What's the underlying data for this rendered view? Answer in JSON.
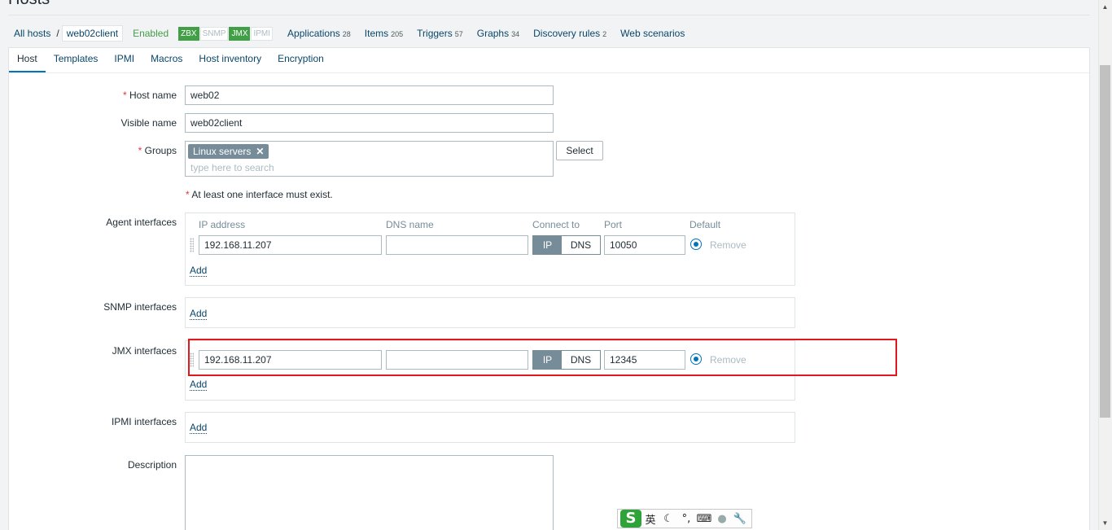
{
  "page": {
    "title": "Hosts"
  },
  "nav": {
    "all_hosts": "All hosts",
    "separator": "/",
    "current_host": "web02client",
    "status": "Enabled",
    "availability": [
      {
        "label": "ZBX",
        "active": true
      },
      {
        "label": "SNMP",
        "active": false
      },
      {
        "label": "JMX",
        "active": true
      },
      {
        "label": "IPMI",
        "active": false
      }
    ],
    "links": [
      {
        "label": "Applications",
        "count": "28"
      },
      {
        "label": "Items",
        "count": "205"
      },
      {
        "label": "Triggers",
        "count": "57"
      },
      {
        "label": "Graphs",
        "count": "34"
      },
      {
        "label": "Discovery rules",
        "count": "2"
      },
      {
        "label": "Web scenarios",
        "count": ""
      }
    ]
  },
  "tabs": [
    "Host",
    "Templates",
    "IPMI",
    "Macros",
    "Host inventory",
    "Encryption"
  ],
  "active_tab": "Host",
  "form": {
    "host_name_label": "Host name",
    "host_name_value": "web02",
    "visible_name_label": "Visible name",
    "visible_name_value": "web02client",
    "groups_label": "Groups",
    "group_chip": "Linux servers",
    "groups_placeholder": "type here to search",
    "select_button": "Select",
    "interface_note": "At least one interface must exist.",
    "agent_label": "Agent interfaces",
    "snmp_label": "SNMP interfaces",
    "jmx_label": "JMX interfaces",
    "ipmi_label": "IPMI interfaces",
    "description_label": "Description",
    "headers": {
      "ip": "IP address",
      "dns": "DNS name",
      "connect": "Connect to",
      "port": "Port",
      "default": "Default"
    },
    "agent_interface": {
      "ip": "192.168.11.207",
      "dns": "",
      "connect_ip": "IP",
      "connect_dns": "DNS",
      "port": "10050",
      "remove": "Remove"
    },
    "jmx_interface": {
      "ip": "192.168.11.207",
      "dns": "",
      "connect_ip": "IP",
      "connect_dns": "DNS",
      "port": "12345",
      "remove": "Remove"
    },
    "add_label": "Add"
  },
  "ime": {
    "lang": "英"
  },
  "colors": {
    "accent": "#0275b8",
    "link": "#0a466a",
    "enabled": "#429e47",
    "highlight": "#e0191e"
  }
}
